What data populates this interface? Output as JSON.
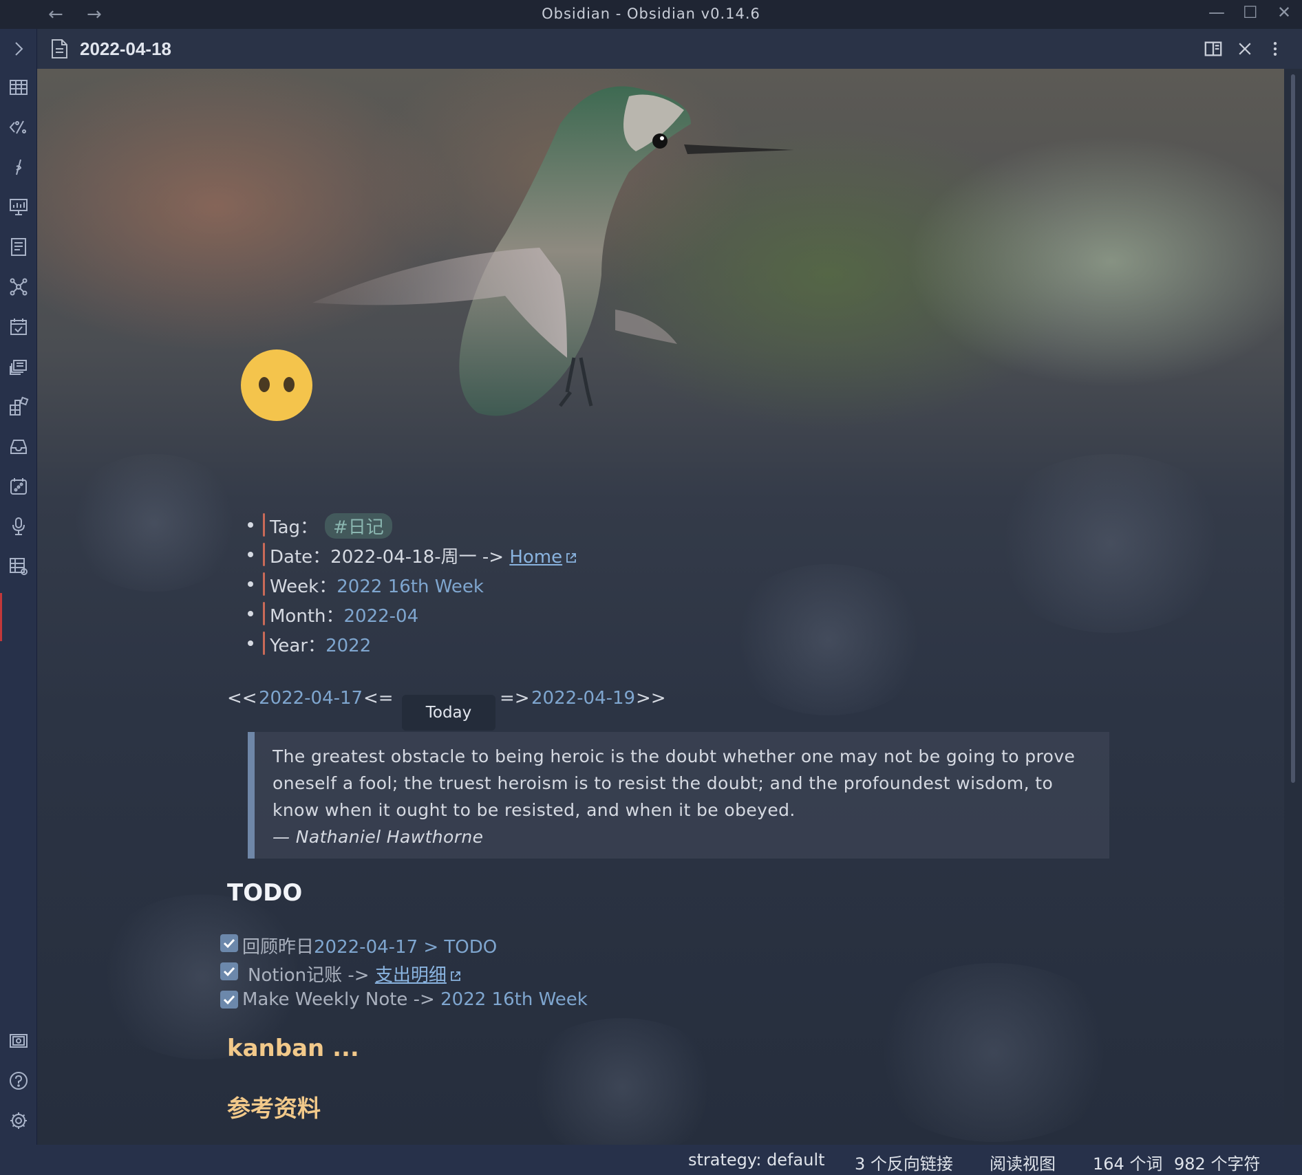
{
  "window": {
    "title": "Obsidian - Obsidian v0.14.6",
    "back_glyph": "←",
    "forward_glyph": "→",
    "minimize_glyph": "—",
    "maximize_glyph": "☐",
    "close_glyph": "✕"
  },
  "ribbon": {
    "icons": [
      "expand-icon",
      "table-icon",
      "templater-icon",
      "pen-icon",
      "slides-icon",
      "outline-icon",
      "graph-icon",
      "calendar-icon",
      "cards-icon",
      "plugin-icon",
      "inbox-icon",
      "dice-icon",
      "microphone-icon",
      "table-settings-icon",
      "vault-icon",
      "help-icon",
      "settings-icon"
    ]
  },
  "note": {
    "title": "2022-04-18",
    "header_icons": [
      "file-icon",
      "split-view-icon",
      "close-icon",
      "more-options-icon"
    ]
  },
  "metadata": {
    "tag_label": "Tag：",
    "tag_value": "#日记",
    "date_label": "Date：",
    "date_value": "2022-04-18-周一 ->",
    "date_link": "Home",
    "week_label": "Week：",
    "week_value": "2022 16th Week",
    "month_label": "Month：",
    "month_value": "2022-04",
    "year_label": "Year：",
    "year_value": "2022"
  },
  "date_nav": {
    "prev_prefix": "<<",
    "prev_date": "2022-04-17",
    "prev_suffix": "<=",
    "today_label": "Today",
    "next_prefix": "=>",
    "next_date": "2022-04-19",
    "next_suffix": ">>"
  },
  "quote": {
    "text": "The greatest obstacle to being heroic is the doubt whether one may not be going to prove oneself a fool; the truest heroism is to resist the doubt; and the profoundest wisdom, to know when it ought to be resisted, and when it be obeyed.",
    "author": "— Nathaniel Hawthorne"
  },
  "todo": {
    "heading": "TODO",
    "items": [
      {
        "prefix": "回顾昨日",
        "link": "2022-04-17 > TODO",
        "checked": true
      },
      {
        "prefix": "Notion记账 ->",
        "link": "支出明细",
        "checked": true
      },
      {
        "prefix": "Make Weekly Note ->",
        "link": "2022 16th Week",
        "checked": true
      }
    ]
  },
  "sections": {
    "kanban": "kanban ...",
    "references": "参考资料"
  },
  "statusbar": {
    "strategy": "strategy: default",
    "backlinks": "3 个反向链接",
    "view_mode": "阅读视图",
    "words": "164 个词",
    "chars": "982 个字符"
  },
  "colors": {
    "accent_link": "#8ab4e0",
    "internal_link": "#7fa6cf",
    "heading_warm": "#f2c98a",
    "quote_border": "#6f87a8",
    "checkbox": "#6c88ab"
  }
}
